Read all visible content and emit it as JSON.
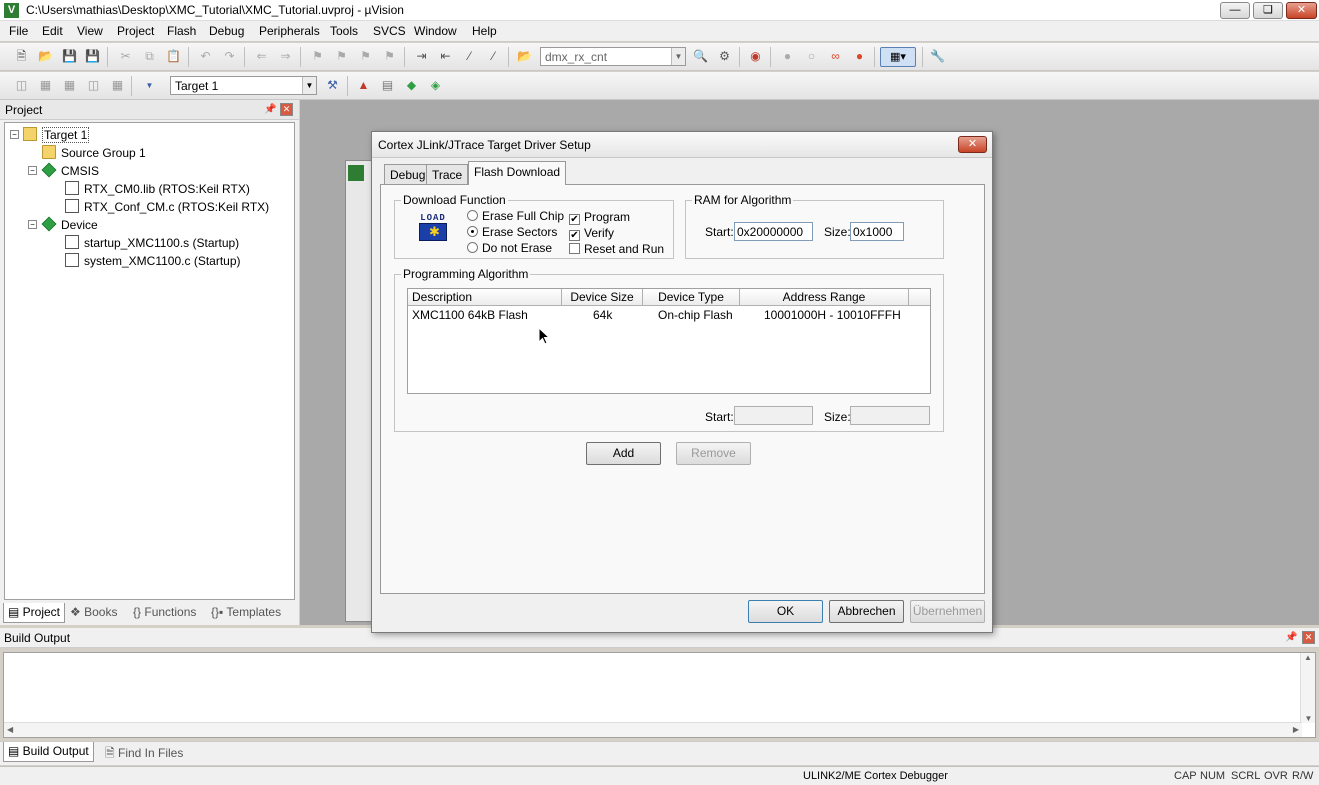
{
  "window": {
    "title": "C:\\Users\\mathias\\Desktop\\XMC_Tutorial\\XMC_Tutorial.uvproj - µVision"
  },
  "menu": [
    "File",
    "Edit",
    "View",
    "Project",
    "Flash",
    "Debug",
    "Peripherals",
    "Tools",
    "SVCS",
    "Window",
    "Help"
  ],
  "toolbar": {
    "find_combo": "dmx_rx_cnt",
    "target_combo": "Target 1"
  },
  "project_panel": {
    "title": "Project",
    "tree": {
      "target": "Target 1",
      "source_group": "Source Group 1",
      "cmsis": "CMSIS",
      "cmsis_files": [
        "RTX_CM0.lib (RTOS:Keil RTX)",
        "RTX_Conf_CM.c (RTOS:Keil RTX)"
      ],
      "device": "Device",
      "device_files": [
        "startup_XMC1100.s (Startup)",
        "system_XMC1100.c (Startup)"
      ]
    },
    "tabs": [
      "Project",
      "Books",
      "Functions",
      "Templates"
    ]
  },
  "build_output": {
    "title": "Build Output",
    "tabs": [
      "Build Output",
      "Find In Files"
    ]
  },
  "statusbar": {
    "debugger": "ULINK2/ME Cortex Debugger",
    "indicators": [
      "CAP",
      "NUM",
      "SCRL",
      "OVR",
      "R/W"
    ]
  },
  "dialog": {
    "title": "Cortex JLink/JTrace Target Driver Setup",
    "tabs": [
      "Debug",
      "Trace",
      "Flash Download"
    ],
    "download_function": {
      "label": "Download Function",
      "load_icon_text": "LOAD",
      "erase_full_chip": "Erase Full Chip",
      "erase_sectors": "Erase Sectors",
      "do_not_erase": "Do not Erase",
      "program": "Program",
      "verify": "Verify",
      "reset_and_run": "Reset and Run"
    },
    "ram": {
      "label": "RAM for Algorithm",
      "start_label": "Start:",
      "start_value": "0x20000000",
      "size_label": "Size:",
      "size_value": "0x1000"
    },
    "programming": {
      "label": "Programming Algorithm",
      "columns": [
        "Description",
        "Device Size",
        "Device Type",
        "Address Range"
      ],
      "rows": [
        {
          "description": "XMC1100 64kB Flash",
          "size": "64k",
          "type": "On-chip Flash",
          "range": "10001000H - 10010FFFH"
        }
      ],
      "start_label": "Start:",
      "size_label": "Size:"
    },
    "buttons": {
      "add": "Add",
      "remove": "Remove",
      "ok": "OK",
      "cancel": "Abbrechen",
      "apply": "Übernehmen"
    }
  }
}
